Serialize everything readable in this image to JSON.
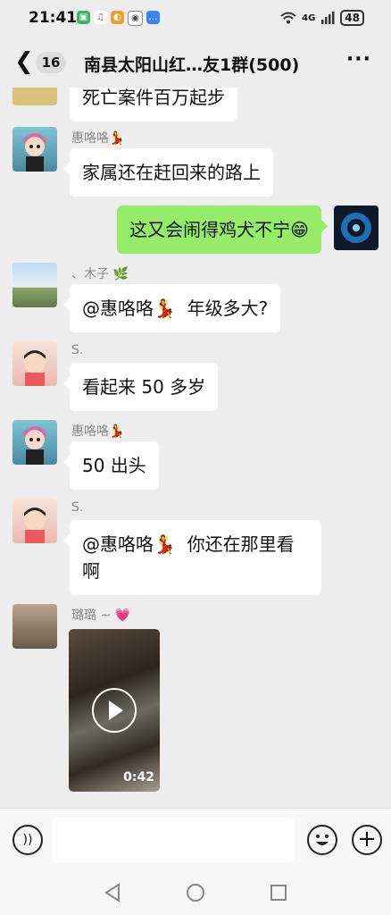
{
  "status": {
    "time": "21:41",
    "network": "4G",
    "battery": "48"
  },
  "header": {
    "back_count": "16",
    "title": "南县太阳山红…友1群(500)",
    "more": "···"
  },
  "messages": [
    {
      "type": "text",
      "direction": "in",
      "text": "死亡案件百万起步",
      "partial": true
    },
    {
      "type": "text",
      "direction": "in",
      "sender": "惠咯咯💃",
      "text": "家属还在赶回来的路上"
    },
    {
      "type": "text",
      "direction": "out",
      "text": "这又会闹得鸡犬不宁😁"
    },
    {
      "type": "text",
      "direction": "in",
      "sender": "、木子 🌿",
      "text": "@惠咯咯💃  年级多大?"
    },
    {
      "type": "text",
      "direction": "in",
      "sender": "S.",
      "text": "看起来 50 多岁"
    },
    {
      "type": "text",
      "direction": "in",
      "sender": "惠咯咯💃",
      "text": "50 出头"
    },
    {
      "type": "text",
      "direction": "in",
      "sender": "S.",
      "text": "@惠咯咯💃  你还在那里看\n啊"
    },
    {
      "type": "video",
      "direction": "in",
      "sender": "璐璐 ~ 💗",
      "duration": "0:42"
    }
  ],
  "input": {
    "placeholder": ""
  },
  "colors": {
    "background": "#ededed",
    "my_bubble": "#95ec69",
    "their_bubble": "#ffffff",
    "sender": "#888888"
  },
  "icons": [
    "back-icon",
    "more-icon",
    "voice-icon",
    "emoji-icon",
    "plus-icon",
    "play-icon",
    "back-triangle-icon",
    "home-circle-icon",
    "recents-square-icon"
  ]
}
